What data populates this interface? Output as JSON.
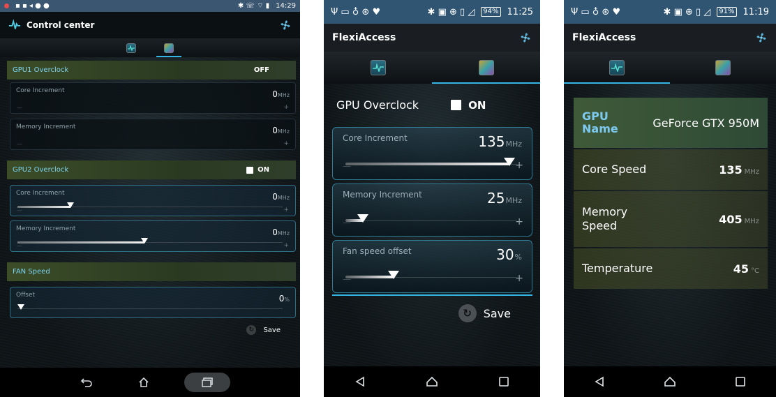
{
  "screen1": {
    "status": {
      "time": "14:29"
    },
    "app_title": "Control center",
    "gpu1": {
      "label": "GPU1 Overclock",
      "state": "OFF",
      "core": {
        "label": "Core Increment",
        "value": "0",
        "unit": "MHz",
        "level": 0.0
      },
      "memory": {
        "label": "Memory Increment",
        "value": "0",
        "unit": "MHz",
        "level": 0.0
      }
    },
    "gpu2": {
      "label": "GPU2 Overclock",
      "state": "ON",
      "core": {
        "label": "Core Increment",
        "value": "0",
        "unit": "MHz",
        "level": 0.2
      },
      "memory": {
        "label": "Memory Increment",
        "value": "0",
        "unit": "MHz",
        "level": 0.48
      }
    },
    "fan": {
      "label": "FAN Speed",
      "offset": {
        "label": "Offset",
        "value": "0",
        "unit": "%",
        "level": 0.0
      }
    },
    "save_label": "Save"
  },
  "screen2": {
    "status": {
      "battery": "94%",
      "time": "11:25"
    },
    "app_title": "FlexiAccess",
    "gpu_overclock": {
      "label": "GPU Overclock",
      "state": "ON"
    },
    "core": {
      "label": "Core Increment",
      "value": "135",
      "unit": "MHz",
      "level": 0.96
    },
    "memory": {
      "label": "Memory Increment",
      "value": "25",
      "unit": "MHz",
      "level": 0.1
    },
    "fan": {
      "label": "Fan speed offset",
      "value": "30",
      "unit": "%",
      "level": 0.28
    },
    "save_label": "Save"
  },
  "screen3": {
    "status": {
      "battery": "91%",
      "time": "11:19"
    },
    "app_title": "FlexiAccess",
    "rows": [
      {
        "label_line1": "GPU",
        "label_line2": "Name",
        "value": "GeForce GTX 950M",
        "unit": ""
      },
      {
        "label_line1": "Core Speed",
        "label_line2": "",
        "value": "135",
        "unit": "MHz"
      },
      {
        "label_line1": "Memory",
        "label_line2": "Speed",
        "value": "405",
        "unit": "MHz"
      },
      {
        "label_line1": "Temperature",
        "label_line2": "",
        "value": "45",
        "unit": "°C"
      }
    ]
  },
  "colors": {
    "accent": "#33b5e5",
    "header_green": "#3c4d28",
    "label_blue": "#7dc9f0",
    "status_bar": "#2f5572"
  },
  "icons": [
    "fan-icon",
    "monitor-tab-icon",
    "gpu-tab-icon",
    "save-icon",
    "back-icon",
    "home-icon",
    "recents-icon"
  ]
}
